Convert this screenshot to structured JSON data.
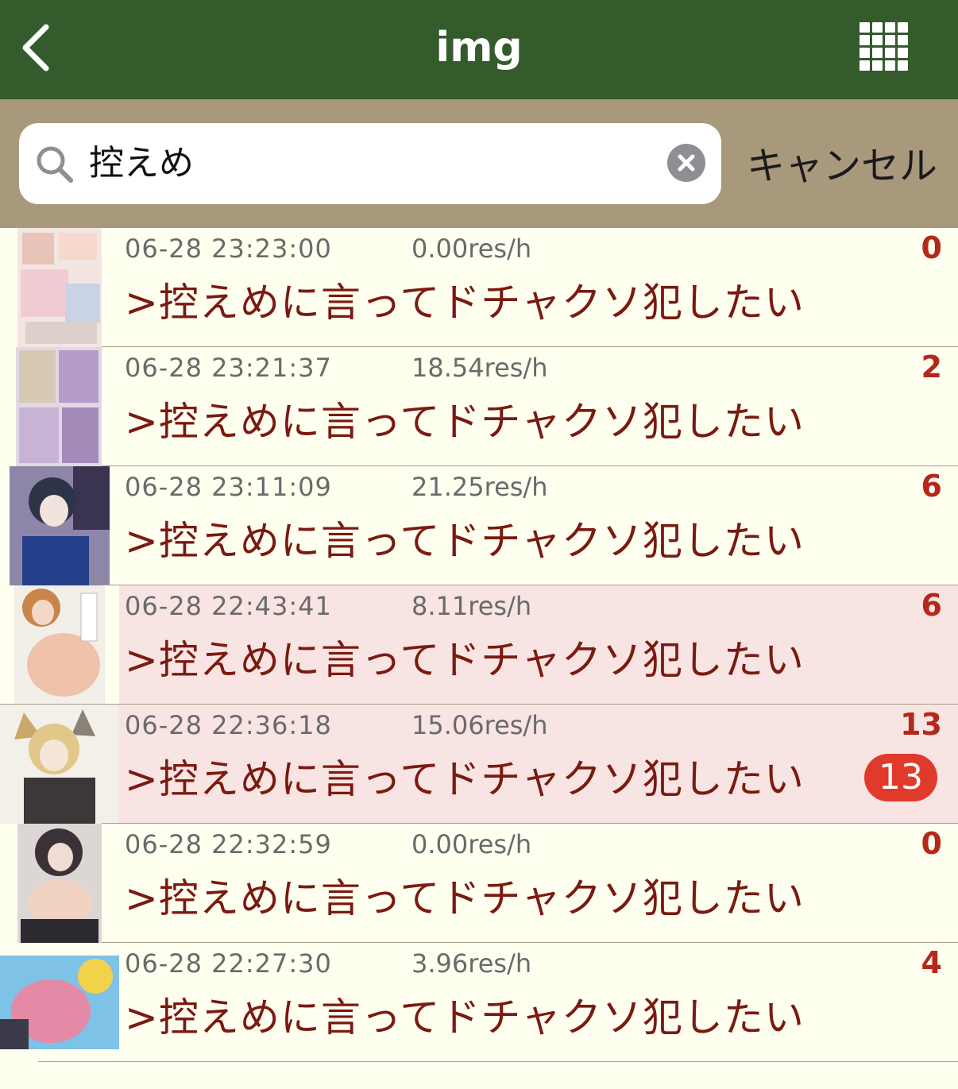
{
  "nav": {
    "title": "img",
    "back_icon": "chevron-left-icon",
    "grid_icon": "grid-icon"
  },
  "search": {
    "value": "控えめ",
    "cancel_label": "キャンセル"
  },
  "threads": [
    {
      "date": "06-28 23:23:00",
      "rate": "0.00res/h",
      "count": "0",
      "title": ">控えめに言ってドチャクソ犯したい",
      "badge": null,
      "highlighted": false
    },
    {
      "date": "06-28 23:21:37",
      "rate": "18.54res/h",
      "count": "2",
      "title": ">控えめに言ってドチャクソ犯したい",
      "badge": null,
      "highlighted": false
    },
    {
      "date": "06-28 23:11:09",
      "rate": "21.25res/h",
      "count": "6",
      "title": ">控えめに言ってドチャクソ犯したい",
      "badge": null,
      "highlighted": false
    },
    {
      "date": "06-28 22:43:41",
      "rate": "8.11res/h",
      "count": "6",
      "title": ">控えめに言ってドチャクソ犯したい",
      "badge": null,
      "highlighted": true
    },
    {
      "date": "06-28 22:36:18",
      "rate": "15.06res/h",
      "count": "13",
      "title": ">控えめに言ってドチャクソ犯したい",
      "badge": "13",
      "highlighted": true
    },
    {
      "date": "06-28 22:32:59",
      "rate": "0.00res/h",
      "count": "0",
      "title": ">控えめに言ってドチャクソ犯したい",
      "badge": null,
      "highlighted": false
    },
    {
      "date": "06-28 22:27:30",
      "rate": "3.96res/h",
      "count": "4",
      "title": ">控えめに言ってドチャクソ犯したい",
      "badge": null,
      "highlighted": false
    }
  ],
  "colors": {
    "navbar": "#345b2c",
    "searchbar": "#a8997c",
    "list_bg": "#fffff0",
    "highlight_bg": "#f8e4e2",
    "title_text": "#7a1a10",
    "count_text": "#b4281c",
    "badge_bg": "#e03a2c"
  }
}
